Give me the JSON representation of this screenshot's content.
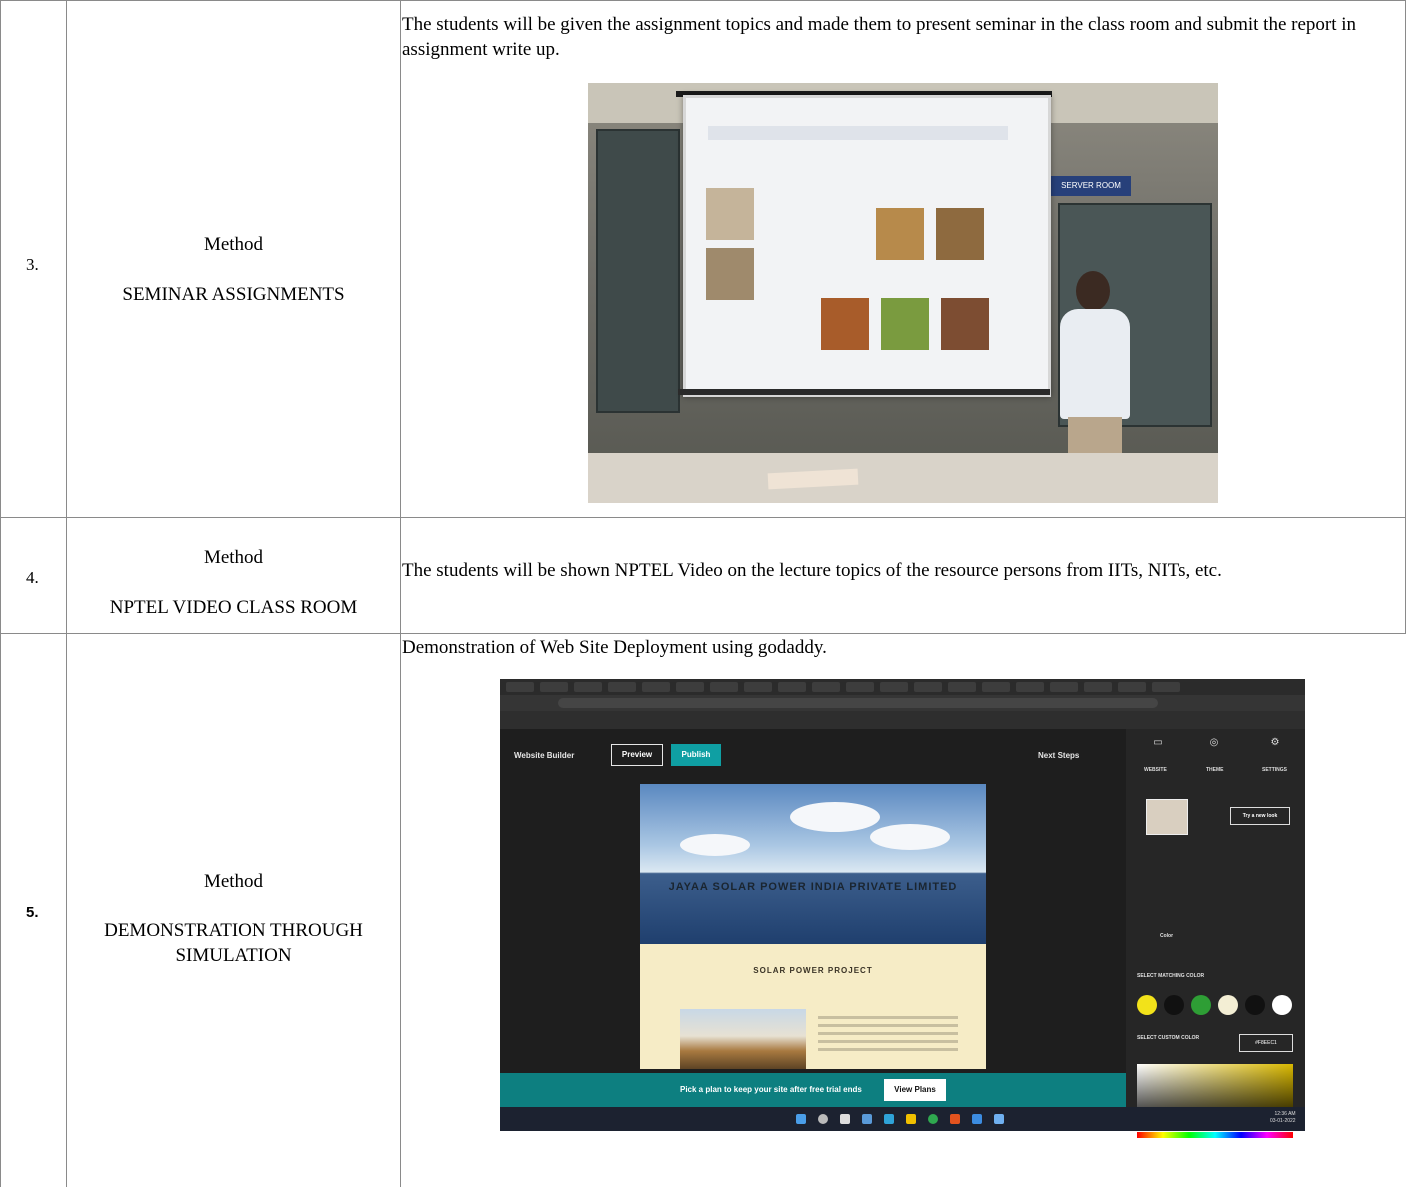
{
  "rows": [
    {
      "number": "3.",
      "method_label": "Method",
      "method_name": "SEMINAR ASSIGNMENTS",
      "description": "The students will be given the assignment topics and made them to present seminar in the class room and submit the report in assignment write up.",
      "photo": {
        "sign_text": "SERVER ROOM"
      }
    },
    {
      "number": "4.",
      "method_label": "Method",
      "method_name": "NPTEL VIDEO CLASS ROOM",
      "description": "The students will be shown NPTEL Video on the lecture topics of the resource persons from IITs, NITs, etc."
    },
    {
      "number": "5.",
      "method_label": "Method",
      "method_name": "DEMONSTRATION THROUGH SIMULATION",
      "description": "Demonstration of Web Site Deployment using godaddy.",
      "screenshot": {
        "builder_label": "Website Builder",
        "preview_label": "Preview",
        "publish_label": "Publish",
        "next_steps_label": "Next Steps",
        "site_title": "JAYAA SOLAR POWER INDIA PRIVATE LIMITED",
        "project_heading": "SOLAR POWER PROJECT",
        "plan_banner_text": "Pick a plan to keep your site after free trial ends",
        "view_plans_label": "View Plans",
        "panel_tabs": [
          "WEBSITE",
          "THEME",
          "SETTINGS"
        ],
        "try_new_look_label": "Try a new look",
        "color_section_label": "Color",
        "select_matching_color_label": "SELECT MATCHING COLOR",
        "select_custom_color_label": "SELECT CUSTOM COLOR",
        "custom_color_hex": "#F8EEC1",
        "swatch_colors": [
          "#f2e21a",
          "#111111",
          "#2e9e35",
          "#f3eed4",
          "#111111",
          "#ffffff"
        ],
        "clock_time": "12:36 AM",
        "clock_date": "03-01-2022"
      }
    }
  ]
}
